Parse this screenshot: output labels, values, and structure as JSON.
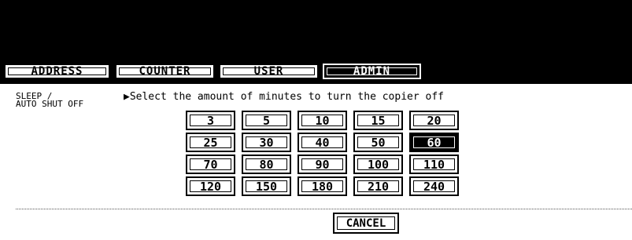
{
  "tabs": [
    {
      "label": "ADDRESS",
      "active": false
    },
    {
      "label": "COUNTER",
      "active": false
    },
    {
      "label": "USER",
      "active": false
    },
    {
      "label": "ADMIN",
      "active": true
    }
  ],
  "setting": {
    "title_line1": "SLEEP /",
    "title_line2": "AUTO SHUT OFF",
    "prompt": "▶Select the amount of minutes to turn the copier off"
  },
  "options": {
    "selected": "60",
    "rows": [
      [
        "3",
        "5",
        "10",
        "15",
        "20"
      ],
      [
        "25",
        "30",
        "40",
        "50",
        "60"
      ],
      [
        "70",
        "80",
        "90",
        "100",
        "110"
      ],
      [
        "120",
        "150",
        "180",
        "210",
        "240"
      ]
    ]
  },
  "cancel_label": "CANCEL"
}
